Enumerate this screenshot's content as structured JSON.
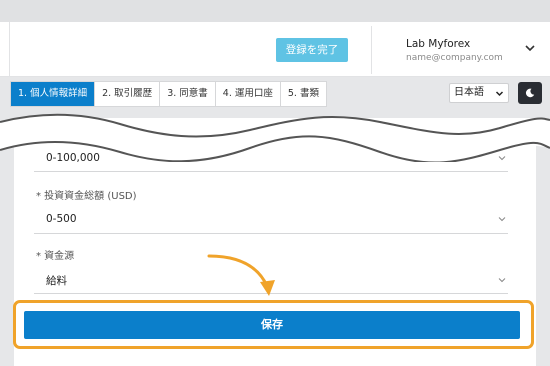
{
  "header": {
    "complete_button": "登録を完了",
    "user_name": "Lab Myforex",
    "user_email": "name@company.com"
  },
  "tabs": [
    {
      "label": "1.  個人情報詳細",
      "active": true
    },
    {
      "label": "2.  取引履歴",
      "active": false
    },
    {
      "label": "3.  同意書",
      "active": false
    },
    {
      "label": "4.  運用口座",
      "active": false
    },
    {
      "label": "5.  書類",
      "active": false
    }
  ],
  "language": {
    "selected": "日本語"
  },
  "form": {
    "prev_field_value": "0-100,000",
    "investment_label": "* 投資資金総額 (USD)",
    "investment_value": "0-500",
    "source_label": "* 資金源",
    "source_value": "給料"
  },
  "save_button": "保存",
  "colors": {
    "primary": "#0b7fcb",
    "complete_button": "#5fc3e4",
    "highlight": "#f0a32a",
    "dark_toggle": "#2a2d33"
  },
  "icons": {
    "user_menu": "chevron-down-icon",
    "dark_mode": "moon-icon",
    "select": "chevron-down-icon",
    "annotation": "curved-arrow-icon"
  }
}
